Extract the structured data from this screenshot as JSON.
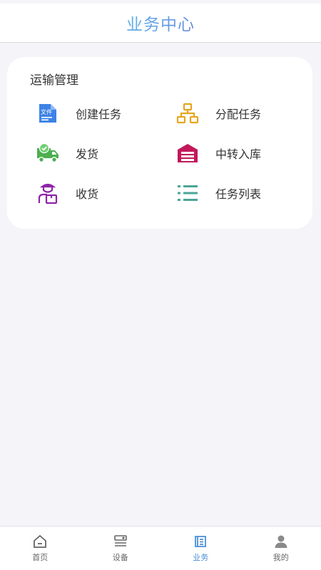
{
  "header": {
    "title": "业务中心"
  },
  "transport": {
    "section_title": "运输管理",
    "items": [
      {
        "label": "创建任务",
        "icon": "file-icon",
        "color": "#3d82e6"
      },
      {
        "label": "分配任务",
        "icon": "org-chart-icon",
        "color": "#e6a51e"
      },
      {
        "label": "发货",
        "icon": "truck-check-icon",
        "color": "#4caf50"
      },
      {
        "label": "中转入库",
        "icon": "warehouse-icon",
        "color": "#c2185b"
      },
      {
        "label": "收货",
        "icon": "courier-icon",
        "color": "#8e24aa"
      },
      {
        "label": "任务列表",
        "icon": "list-icon",
        "color": "#4aa597"
      }
    ],
    "file_icon_text": "文件"
  },
  "tabbar": {
    "tabs": [
      {
        "label": "首页",
        "icon": "home-icon"
      },
      {
        "label": "设备",
        "icon": "device-icon"
      },
      {
        "label": "业务",
        "icon": "business-icon"
      },
      {
        "label": "我的",
        "icon": "user-icon"
      }
    ],
    "active_color": "#4a8fd6",
    "inactive_color": "#666666"
  }
}
